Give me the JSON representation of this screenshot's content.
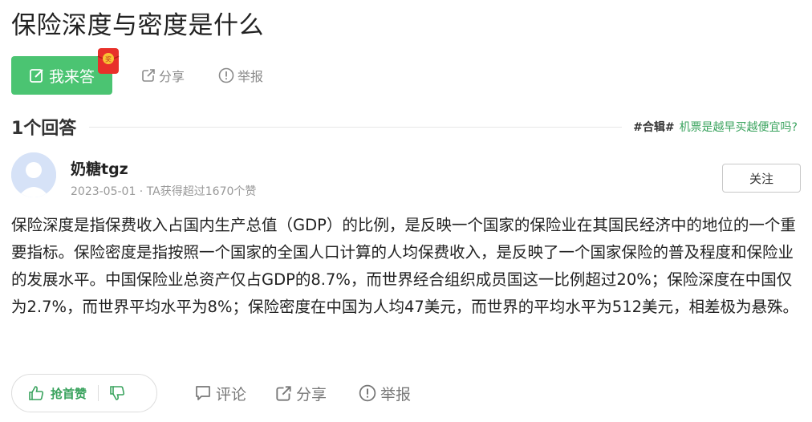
{
  "question": {
    "title": "保险深度与密度是什么"
  },
  "actions": {
    "answer_label": "我来答",
    "redpacket_badge": "奖",
    "share_label": "分享",
    "report_label": "举报"
  },
  "answers_header": {
    "count_label": "1个回答",
    "topic_tag": "#合辑#",
    "topic_link": "机票是越早买越便宜吗?"
  },
  "answer": {
    "author_name": "奶糖tgz",
    "meta": "2023-05-01 · TA获得超过1670个赞",
    "follow_label": "关注",
    "content": "保险深度是指保费收入占国内生产总值（GDP）的比例，是反映一个国家的保险业在其国民经济中的地位的一个重要指标。保险密度是指按照一个国家的全国人口计算的人均保费收入，是反映了一个国家保险的普及程度和保险业的发展水平。中国保险业总资产仅占GDP的8.7%，而世界经合组织成员国这一比例超过20%；保险深度在中国仅为2.7%，而世界平均水平为8%；保险密度在中国为人均47美元，而世界的平均水平为512美元，相差极为悬殊。"
  },
  "footer": {
    "upvote_label": "抢首赞",
    "comment_label": "评论",
    "share_label": "分享",
    "report_label": "举报"
  },
  "colors": {
    "accent_green": "#4bc472",
    "link_green": "#3aa35e",
    "muted_gray": "#8a8a8a",
    "redpacket_red": "#e8302a"
  },
  "icons": [
    "edit-icon",
    "redpacket-icon",
    "share-icon",
    "report-icon",
    "avatar-icon",
    "thumbs-up-icon",
    "thumbs-down-icon",
    "comment-icon"
  ]
}
